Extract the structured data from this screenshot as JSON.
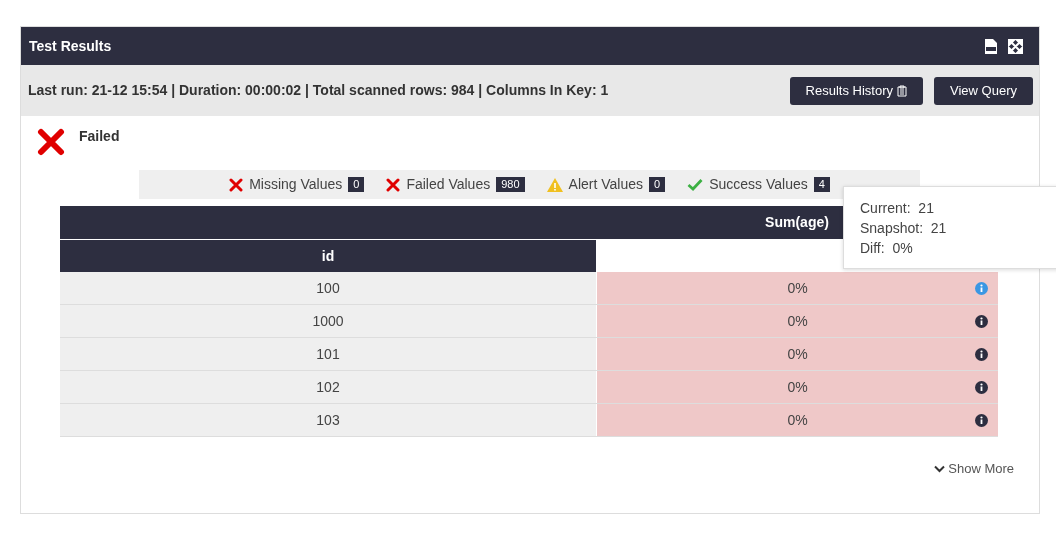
{
  "panel": {
    "title": "Test Results"
  },
  "info_bar": {
    "text": "Last run: 21-12 15:54 | Duration: 00:00:02 | Total scanned rows: 984 | Columns In Key: 1",
    "buttons": [
      {
        "label": "Results History",
        "kind": "history"
      },
      {
        "label": "View Query",
        "kind": "plain"
      }
    ]
  },
  "status": {
    "kind": "failed",
    "label": "Failed"
  },
  "summary": [
    {
      "kind": "missing",
      "label": "Missing Values",
      "count": "0"
    },
    {
      "kind": "failed",
      "label": "Failed Values",
      "count": "980"
    },
    {
      "kind": "alert",
      "label": "Alert Values",
      "count": "0"
    },
    {
      "kind": "success",
      "label": "Success Values",
      "count": "4"
    }
  ],
  "table": {
    "group_header": "Sum(age)",
    "key_header": "id",
    "rows": [
      {
        "id": "100",
        "value": "0%",
        "failed": true,
        "selected": true
      },
      {
        "id": "1000",
        "value": "0%",
        "failed": true,
        "selected": false
      },
      {
        "id": "101",
        "value": "0%",
        "failed": true,
        "selected": false
      },
      {
        "id": "102",
        "value": "0%",
        "failed": true,
        "selected": false
      },
      {
        "id": "103",
        "value": "0%",
        "failed": true,
        "selected": false
      }
    ]
  },
  "tooltip": {
    "lines": [
      {
        "label": "Current:",
        "value": "21"
      },
      {
        "label": "Snapshot:",
        "value": "21"
      },
      {
        "label": "Diff:",
        "value": "0%"
      }
    ]
  },
  "show_more": "Show More"
}
